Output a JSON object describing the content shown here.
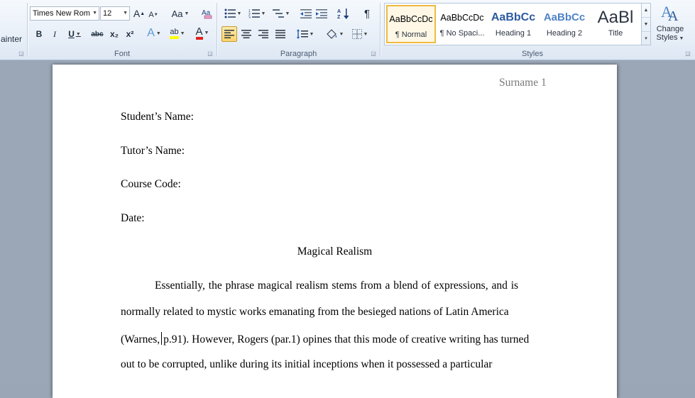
{
  "ribbon": {
    "clipboard": {
      "format_painter_partial": "ainter"
    },
    "font": {
      "group_label": "Font",
      "font_name": "Times New Rom",
      "font_size": "12",
      "grow_font": "A",
      "shrink_font": "A",
      "change_case": "Aa",
      "bold": "B",
      "italic": "I",
      "underline": "U",
      "strikethrough": "abc",
      "subscript": "x₂",
      "superscript": "x²",
      "text_effects": "A",
      "highlight": "ab",
      "font_color": "A",
      "accent_red": "#e02020",
      "accent_yellow": "#ffff00"
    },
    "paragraph": {
      "group_label": "Paragraph",
      "show_marks": "¶"
    },
    "styles": {
      "group_label": "Styles",
      "tiles": [
        {
          "sample": "AaBbCcDc",
          "name": "¶ Normal"
        },
        {
          "sample": "AaBbCcDc",
          "name": "¶ No Spaci..."
        },
        {
          "sample": "AaBbCc",
          "name": "Heading 1"
        },
        {
          "sample": "AaBbCc",
          "name": "Heading 2"
        },
        {
          "sample": "AaBl",
          "name": "Title"
        }
      ],
      "change_styles_line1": "Change",
      "change_styles_line2": "Styles"
    }
  },
  "document": {
    "header": "Surname 1",
    "lines": {
      "student": "Student’s Name:",
      "tutor": "Tutor’s Name:",
      "course": "Course Code:",
      "date": "Date:",
      "title": "Magical Realism",
      "p1": "Essentially, the phrase magical realism stems from a blend of expressions, and is",
      "p2": "normally related to mystic works emanating from the besieged nations of Latin America",
      "p3a": "(Warnes,",
      "p3b": "p.91). However, Rogers (par.1) opines that this mode of creative writing has turned",
      "p4": "out to be corrupted, unlike during its initial inceptions when it possessed a particular"
    }
  }
}
